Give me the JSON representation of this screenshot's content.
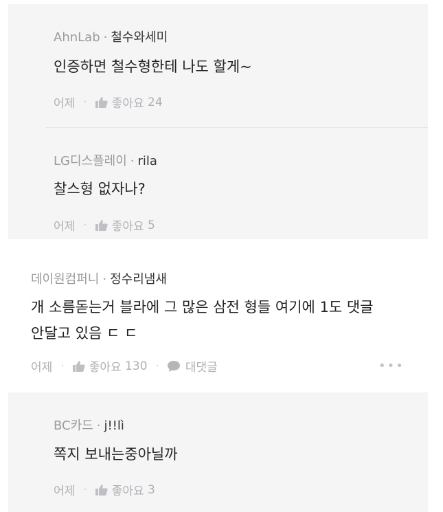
{
  "comments": [
    {
      "company": "AhnLab",
      "nickname": "철수와세미",
      "text": "인증하면 철수형한테 나도 할게~",
      "date": "어제",
      "like_label": "좋아요",
      "like_count": "24"
    },
    {
      "company": "LG디스플레이",
      "nickname": "rila",
      "text": "찰스형 없자나?",
      "date": "어제",
      "like_label": "좋아요",
      "like_count": "5"
    },
    {
      "company": "데이원컴퍼니",
      "nickname": "정수리냄새",
      "text_line1": "개 소름돋는거 블라에 그 많은 삼전 형들 여기에 1도 댓글",
      "text_line2": "안달고 있음 ㄷ ㄷ",
      "date": "어제",
      "like_label": "좋아요",
      "like_count": "130",
      "reply_label": "대댓글",
      "more_label": "•••"
    },
    {
      "company": "BC카드",
      "nickname": "j!!lì",
      "text": "쪽지 보내는중아닐까",
      "date": "어제",
      "like_label": "좋아요",
      "like_count": "3"
    }
  ],
  "separator_dot": "·",
  "colors": {
    "reply_bg": "#f5f5f6",
    "meta": "#9a9a9f",
    "text": "#222222"
  },
  "icons": [
    "thumbs-up-icon",
    "speech-bubble-icon",
    "more-dots-icon"
  ]
}
